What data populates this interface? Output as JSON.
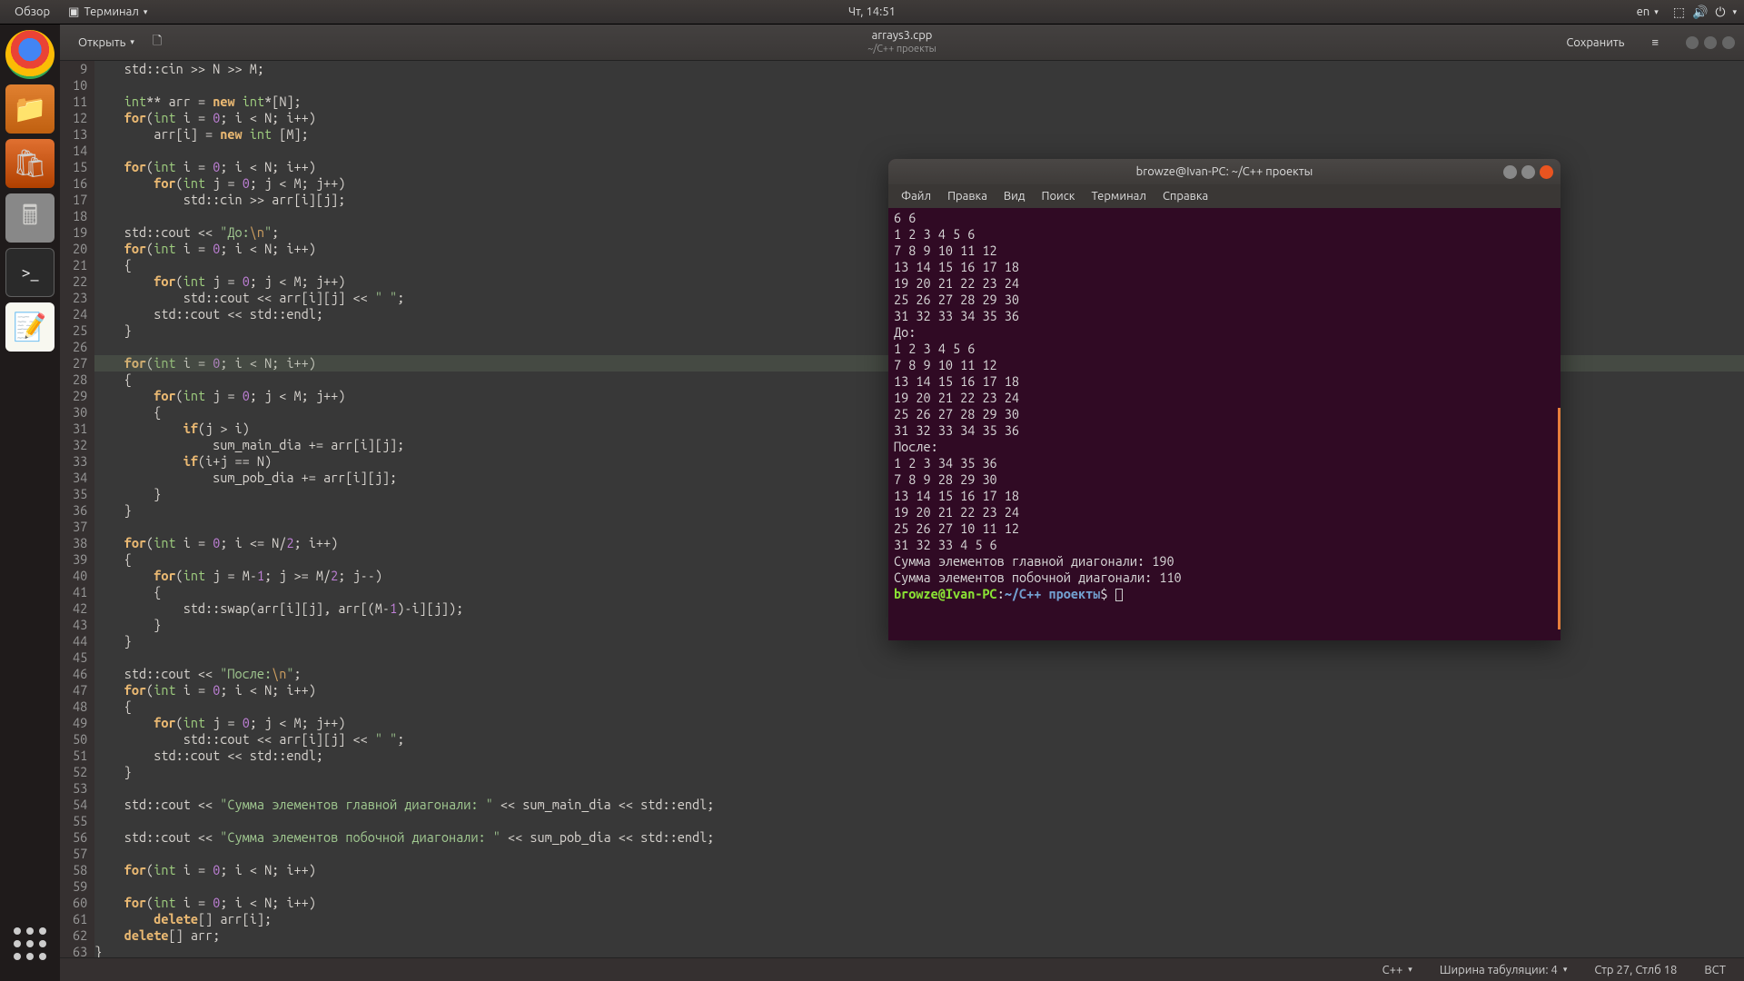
{
  "topbar": {
    "activities": "Обзор",
    "app_label": "Терминал",
    "clock": "Чт, 14:51",
    "lang": "en"
  },
  "dock": {
    "items": [
      "chrome",
      "files",
      "software",
      "calculator",
      "terminal",
      "text-editor"
    ],
    "apps_label": "Show Applications"
  },
  "editor": {
    "open_label": "Открыть",
    "title": "arrays3.cpp",
    "subtitle": "~/C++ проекты",
    "save_label": "Сохранить",
    "statusbar": {
      "lang": "C++",
      "tab": "Ширина табуляции: 4",
      "pos": "Стр 27, Стлб 18",
      "ins": "ВСТ"
    },
    "first_line_no": 9,
    "highlighted_line_no": 27,
    "code_lines": [
      "    std::cin >> N >> M;",
      "",
      "    int** arr = new int*[N];",
      "    for(int i = 0; i < N; i++)",
      "        arr[i] = new int [M];",
      "",
      "    for(int i = 0; i < N; i++)",
      "        for(int j = 0; j < M; j++)",
      "            std::cin >> arr[i][j];",
      "",
      "    std::cout << \"До:\\n\";",
      "    for(int i = 0; i < N; i++)",
      "    {",
      "        for(int j = 0; j < M; j++)",
      "            std::cout << arr[i][j] << \" \";",
      "        std::cout << std::endl;",
      "    }",
      "",
      "    for(int i = 0; i < N; i++)",
      "    {",
      "        for(int j = 0; j < M; j++)",
      "        {",
      "            if(j > i)",
      "                sum_main_dia += arr[i][j];",
      "            if(i+j == N)",
      "                sum_pob_dia += arr[i][j];",
      "        }",
      "    }",
      "",
      "    for(int i = 0; i <= N/2; i++)",
      "    {",
      "        for(int j = M-1; j >= M/2; j--)",
      "        {",
      "            std::swap(arr[i][j], arr[(M-1)-i][j]);",
      "        }",
      "    }",
      "",
      "    std::cout << \"После:\\n\";",
      "    for(int i = 0; i < N; i++)",
      "    {",
      "        for(int j = 0; j < M; j++)",
      "            std::cout << arr[i][j] << \" \";",
      "        std::cout << std::endl;",
      "    }",
      "",
      "    std::cout << \"Сумма элементов главной диагонали: \" << sum_main_dia << std::endl;",
      "",
      "    std::cout << \"Сумма элементов побочной диагонали: \" << sum_pob_dia << std::endl;",
      "",
      "    for(int i = 0; i < N; i++)",
      "",
      "    for(int i = 0; i < N; i++)",
      "        delete[] arr[i];",
      "    delete[] arr;",
      "}"
    ]
  },
  "terminal": {
    "title": "browze@Ivan-PC: ~/C++ проекты",
    "menus": [
      "Файл",
      "Правка",
      "Вид",
      "Поиск",
      "Терминал",
      "Справка"
    ],
    "output_lines": [
      "6 6",
      "1 2 3 4 5 6",
      "7 8 9 10 11 12",
      "13 14 15 16 17 18",
      "19 20 21 22 23 24",
      "25 26 27 28 29 30",
      "31 32 33 34 35 36",
      "До:",
      "1 2 3 4 5 6 ",
      "7 8 9 10 11 12 ",
      "13 14 15 16 17 18 ",
      "19 20 21 22 23 24 ",
      "25 26 27 28 29 30 ",
      "31 32 33 34 35 36 ",
      "После:",
      "1 2 3 34 35 36 ",
      "7 8 9 28 29 30 ",
      "13 14 15 16 17 18 ",
      "19 20 21 22 23 24 ",
      "25 26 27 10 11 12 ",
      "31 32 33 4 5 6 ",
      "Сумма элементов главной диагонали: 190",
      "Сумма элементов побочной диагонали: 110"
    ],
    "prompt_user": "browze@Ivan-PC",
    "prompt_path": "~/C++ проекты",
    "prompt_suffix": "$"
  }
}
